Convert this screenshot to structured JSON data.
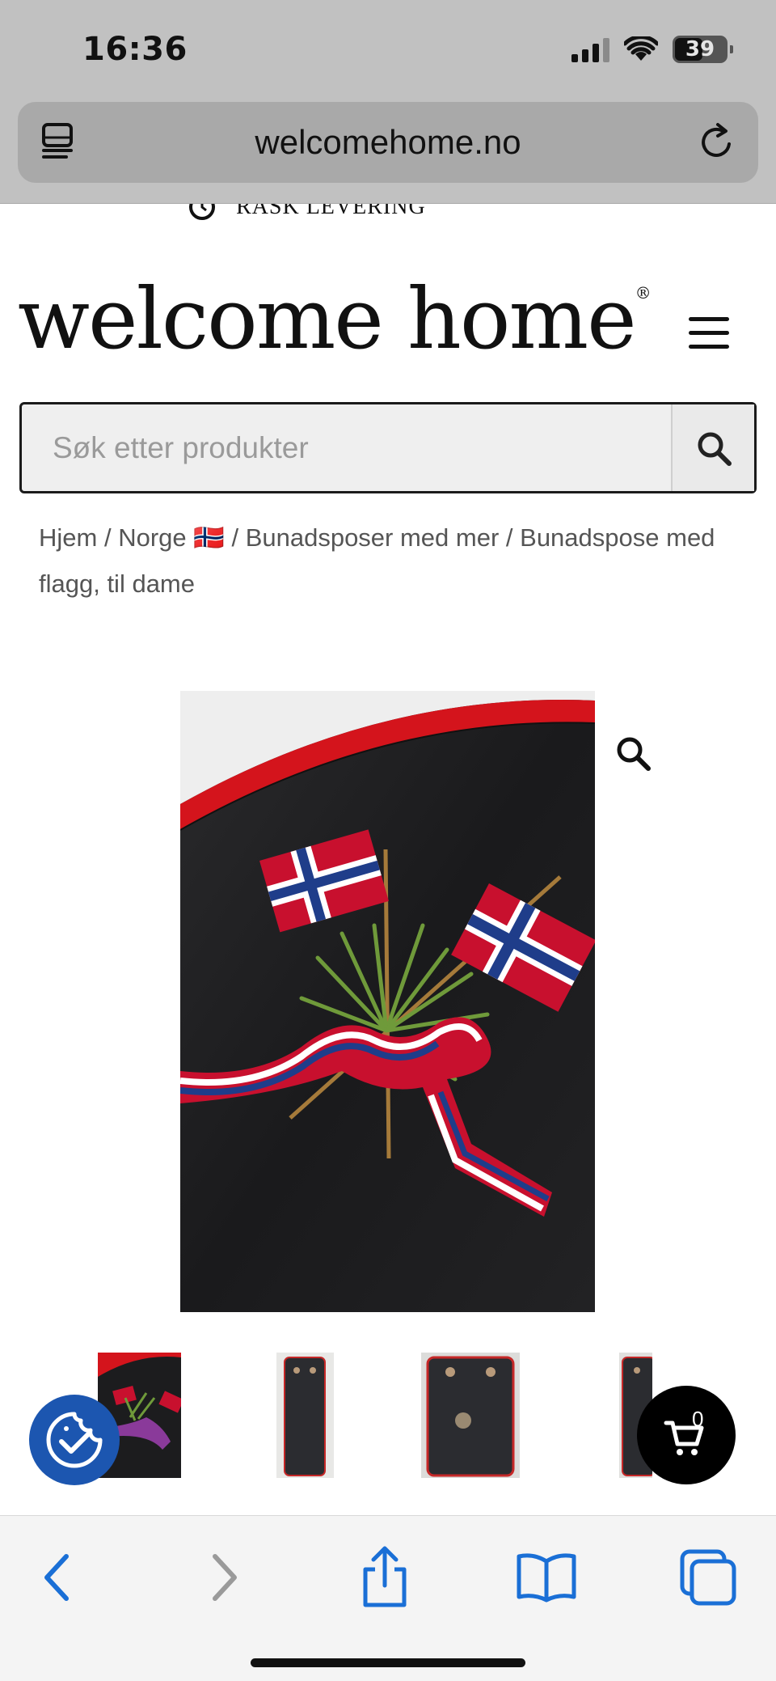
{
  "status_bar": {
    "time": "16:36",
    "battery_percent": "39"
  },
  "browser": {
    "url": "welcomehome.no",
    "left_icon": "reader-view-icon",
    "right_icon": "reload-icon"
  },
  "promo": {
    "text": "RASK LEVERING",
    "icon": "clock-icon"
  },
  "header": {
    "logo_text": "welcome home",
    "logo_mark": "®",
    "menu_icon": "hamburger-menu-icon"
  },
  "search": {
    "placeholder": "Søk etter produkter",
    "button_icon": "search-icon"
  },
  "breadcrumb": {
    "items": [
      "Hjem",
      "Norge 🇳🇴",
      "Bunadsposer med mer",
      "Bunadspose med flagg, til dame"
    ],
    "separator": " / "
  },
  "product": {
    "image_description_icon": "product-photo",
    "zoom_icon": "magnifier-icon",
    "thumbnail_count": 4
  },
  "floating": {
    "cookie_icon": "cookie-consent-icon",
    "cart_icon": "cart-icon",
    "cart_count": "0"
  },
  "toolbar": {
    "back_icon": "back-arrow-icon",
    "forward_icon": "forward-arrow-icon",
    "share_icon": "share-icon",
    "bookmarks_icon": "bookmarks-icon",
    "tabs_icon": "tabs-icon"
  },
  "colors": {
    "chrome_gray": "#c1c1c1",
    "url_pill": "#a9a9a9",
    "ios_blue": "#1a6fd6",
    "cookie_blue": "#1c56b0",
    "flag_red": "#c8102e",
    "flag_blue": "#1f3d8a"
  }
}
